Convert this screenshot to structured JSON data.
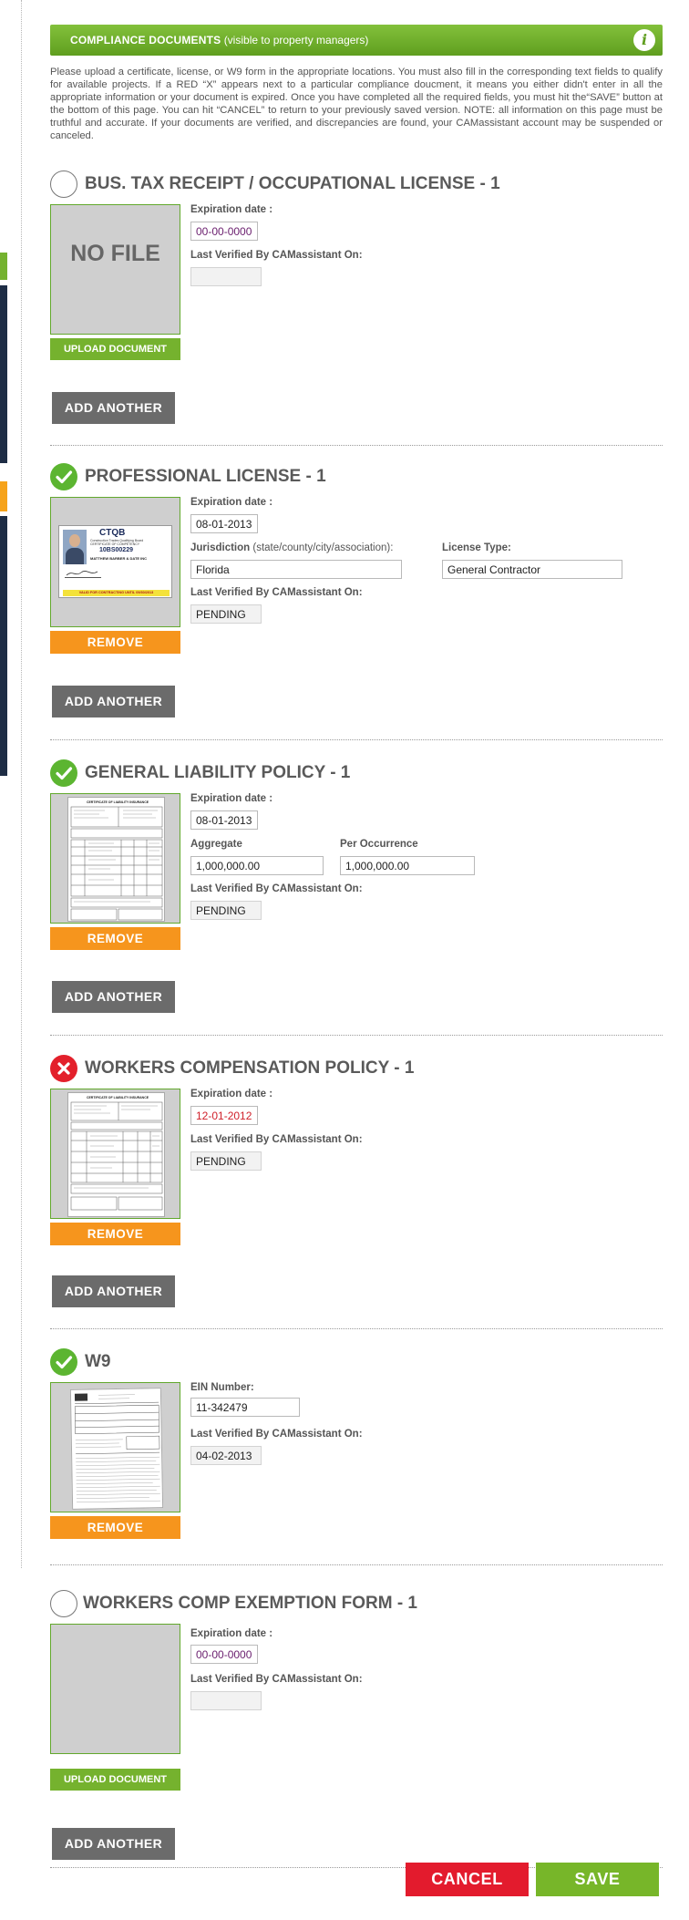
{
  "banner": {
    "title": "COMPLIANCE DOCUMENTS",
    "subtitle": "(visible to property managers)",
    "info_icon": "info-icon"
  },
  "intro": "Please upload a certificate, license, or W9 form in the appropriate locations.  You must also fill in the corresponding text fields to qualify for available projects.  If a RED “X” appears next to a particular compliance doucment, it means you either didn't enter in all the appropriate information or your document is expired.  Once you have completed all the required fields, you must hit the“SAVE” button at the bottom of this page.  You can hit “CANCEL” to return to your previously saved version.  NOTE: all information on this page must be truthful and accurate. If your documents are verified, and discrepancies are found, your CAMassistant account may be suspended or canceled.",
  "labels": {
    "expiration": "Expiration date :",
    "verified": "Last Verified By CAMassistant On:",
    "upload": "UPLOAD DOCUMENT",
    "remove": "REMOVE",
    "add_another": "ADD ANOTHER",
    "no_file": "NO FILE"
  },
  "sections": [
    {
      "title": "BUS. TAX RECEIPT / OCCUPATIONAL LICENSE - 1",
      "status": "empty",
      "expiration": "00-00-0000",
      "verified": ""
    },
    {
      "title": "PROFESSIONAL LICENSE - 1",
      "status": "complete",
      "expiration": "08-01-2013",
      "jurisdiction_label": "Jurisdiction",
      "jurisdiction_hint": "(state/county/city/association):",
      "jurisdiction": "Florida",
      "license_type_label": "License Type:",
      "license_type": "General Contractor",
      "verified": "PENDING",
      "card": {
        "org": "CTQB",
        "line1": "Construction Trades Qualifying Board",
        "line2": "CERTIFICATE OF COMPETENCY",
        "number": "10BS00229",
        "name": "MATTHEW BARBER & DATE INC",
        "validity": "VALID FOR CONTRACTING UNTIL 09/30/2013"
      }
    },
    {
      "title": "GENERAL LIABILITY POLICY - 1",
      "status": "complete",
      "expiration": "08-01-2013",
      "aggregate_label": "Aggregate",
      "aggregate": "1,000,000.00",
      "per_occurrence_label": "Per Occurrence",
      "per_occurrence": "1,000,000.00",
      "verified": "PENDING",
      "doc_heading": "CERTIFICATE OF LIABILITY INSURANCE"
    },
    {
      "title": "WORKERS COMPENSATION POLICY - 1",
      "status": "error",
      "expiration": "12-01-2012",
      "verified": "PENDING",
      "doc_heading": "CERTIFICATE OF LIABILITY INSURANCE"
    },
    {
      "title": "W9",
      "status": "complete",
      "ein_label": "EIN Number:",
      "ein": "11-342479",
      "verified": "04-02-2013"
    },
    {
      "title": "WORKERS COMP EXEMPTION FORM - 1",
      "status": "empty",
      "expiration": "00-00-0000",
      "verified": ""
    }
  ],
  "footer": {
    "cancel": "CANCEL",
    "save": "SAVE"
  },
  "colors": {
    "brand_green": "#75b22e",
    "remove_orange": "#f6951d",
    "add_grey": "#6b6b6b",
    "cancel_red": "#e31b2d",
    "error_red": "#e3202b"
  }
}
